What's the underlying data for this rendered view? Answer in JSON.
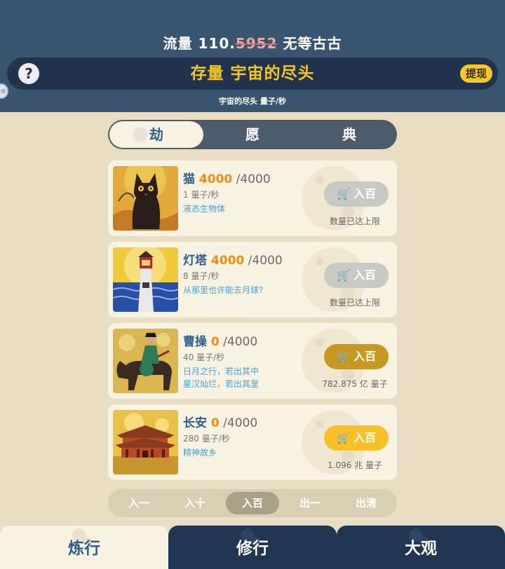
{
  "header": {
    "flow_label": "流量",
    "flow_value_prefix": "110.",
    "flow_value_flicker": "5952",
    "flow_unit": "无等古古",
    "help_icon_char": "?",
    "stock_title": "存量 宇宙的尽头",
    "withdraw_label": "提现",
    "rate_text": "宇宙的尽头  量子/秒"
  },
  "category_tabs": [
    {
      "label": "劫",
      "active": true
    },
    {
      "label": "愿",
      "active": false
    },
    {
      "label": "典",
      "active": false
    }
  ],
  "items": [
    {
      "name": "猫",
      "owned": "4000",
      "cap": " /4000",
      "rate": "1 量子/秒",
      "desc": [
        "液态生物体"
      ],
      "buy_label": "入百",
      "buy_state": "disabled",
      "note": "数量已达上限",
      "image_icon": "cat-image"
    },
    {
      "name": "灯塔",
      "owned": "4000",
      "cap": " /4000",
      "rate": "8 量子/秒",
      "desc": [
        "从那里也许能去月球?"
      ],
      "buy_label": "入百",
      "buy_state": "disabled",
      "note": "数量已达上限",
      "image_icon": "lighthouse-image"
    },
    {
      "name": "曹操",
      "owned": "0",
      "cap": " /4000",
      "rate": "40 量子/秒",
      "desc": [
        "日月之行，若出其中",
        "星汉灿烂，若出其里"
      ],
      "buy_label": "入百",
      "buy_state": "dark",
      "note": "782.875 亿 量子",
      "image_icon": "warlord-on-horse-image"
    },
    {
      "name": "长安",
      "owned": "0",
      "cap": " /4000",
      "rate": "280 量子/秒",
      "desc": [
        "精神故乡"
      ],
      "buy_label": "入百",
      "buy_state": "bright",
      "note": "1.096 兆 量子",
      "image_icon": "palace-image"
    }
  ],
  "quantity_options": [
    {
      "label": "入一",
      "active": false
    },
    {
      "label": "入十",
      "active": false
    },
    {
      "label": "入百",
      "active": true
    },
    {
      "label": "出一",
      "active": false
    },
    {
      "label": "出清",
      "active": false
    }
  ],
  "bottom_nav": [
    {
      "label": "炼行",
      "active": true
    },
    {
      "label": "修行",
      "active": false
    },
    {
      "label": "大观",
      "active": false
    }
  ],
  "colors": {
    "header_bg": "#3a5570",
    "stock_bar_bg": "#22344d",
    "gold": "#f5c61f",
    "page_bg": "#e9dec4",
    "card_bg": "#f8f2e2",
    "name_blue": "#2f5f8f",
    "owned_orange": "#f08c13",
    "desc_blue": "#4b9fd6"
  }
}
